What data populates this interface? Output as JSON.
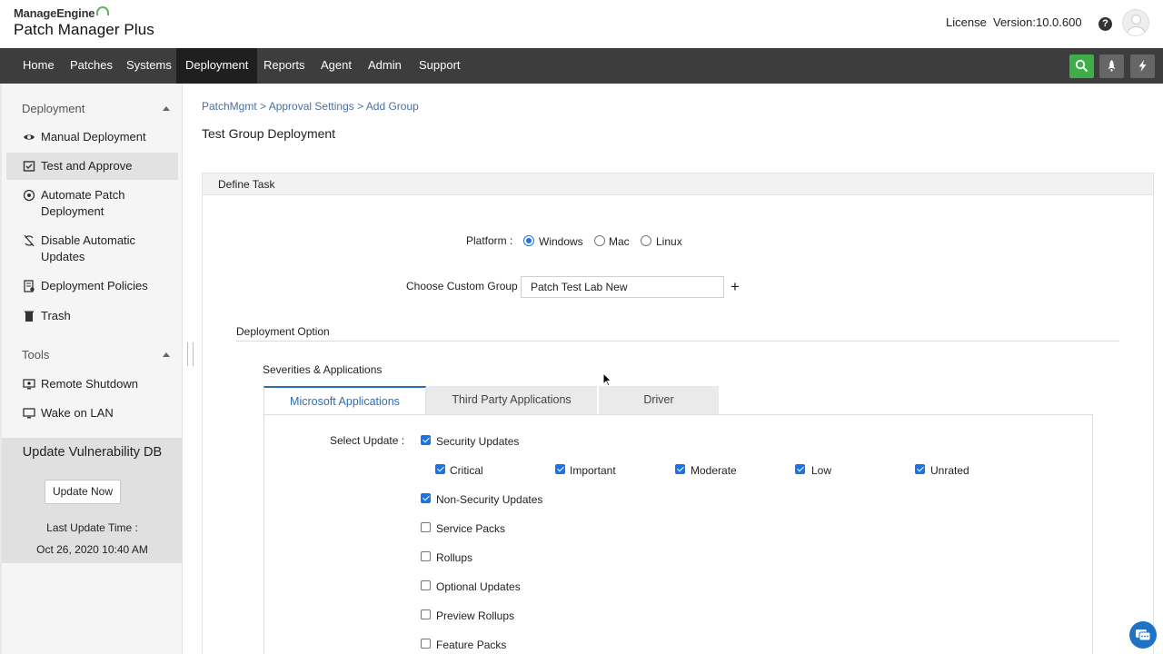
{
  "header": {
    "brand": "ManageEngine",
    "product": "Patch Manager Plus",
    "license": "License",
    "version": "Version:10.0.600"
  },
  "nav": {
    "items": [
      "Home",
      "Patches",
      "Systems",
      "Deployment",
      "Reports",
      "Agent",
      "Admin",
      "Support"
    ],
    "active": "Deployment"
  },
  "sidebar": {
    "deployment_section": "Deployment",
    "items": [
      {
        "label": "Manual Deployment"
      },
      {
        "label": "Test and Approve"
      },
      {
        "label": "Automate Patch Deployment"
      },
      {
        "label": "Disable Automatic Updates"
      },
      {
        "label": "Deployment Policies"
      },
      {
        "label": "Trash"
      }
    ],
    "tools_section": "Tools",
    "tools": [
      {
        "label": "Remote Shutdown"
      },
      {
        "label": "Wake on LAN"
      }
    ],
    "update_box": {
      "title": "Update Vulnerability DB",
      "button": "Update Now",
      "last_update_label": "Last Update Time :",
      "last_update_value": "Oct 26, 2020 10:40 AM"
    }
  },
  "main": {
    "breadcrumb": "PatchMgmt > Approval Settings > Add Group",
    "title": "Test Group Deployment",
    "panel_title": "Define Task",
    "platform_label": "Platform :",
    "platforms": [
      "Windows",
      "Mac",
      "Linux"
    ],
    "platform_selected": "Windows",
    "custom_group_label": "Choose Custom Group :",
    "custom_group_value": "Patch Test Lab New",
    "deployment_option": "Deployment Option",
    "severities_title": "Severities & Applications",
    "tabs": [
      "Microsoft Applications",
      "Third Party Applications",
      "Driver"
    ],
    "active_tab": "Microsoft Applications",
    "select_update_label": "Select Update :",
    "security_updates": "Security Updates",
    "severities": [
      "Critical",
      "Important",
      "Moderate",
      "Low",
      "Unrated"
    ],
    "update_types": [
      {
        "label": "Non-Security Updates",
        "checked": true
      },
      {
        "label": "Service Packs",
        "checked": false
      },
      {
        "label": "Rollups",
        "checked": false
      },
      {
        "label": "Optional Updates",
        "checked": false
      },
      {
        "label": "Preview Rollups",
        "checked": false
      },
      {
        "label": "Feature Packs",
        "checked": false
      }
    ]
  },
  "colors": {
    "nav_bg": "#3d3d3d",
    "accent_blue": "#2d6db5",
    "search_green": "#3fae49"
  }
}
